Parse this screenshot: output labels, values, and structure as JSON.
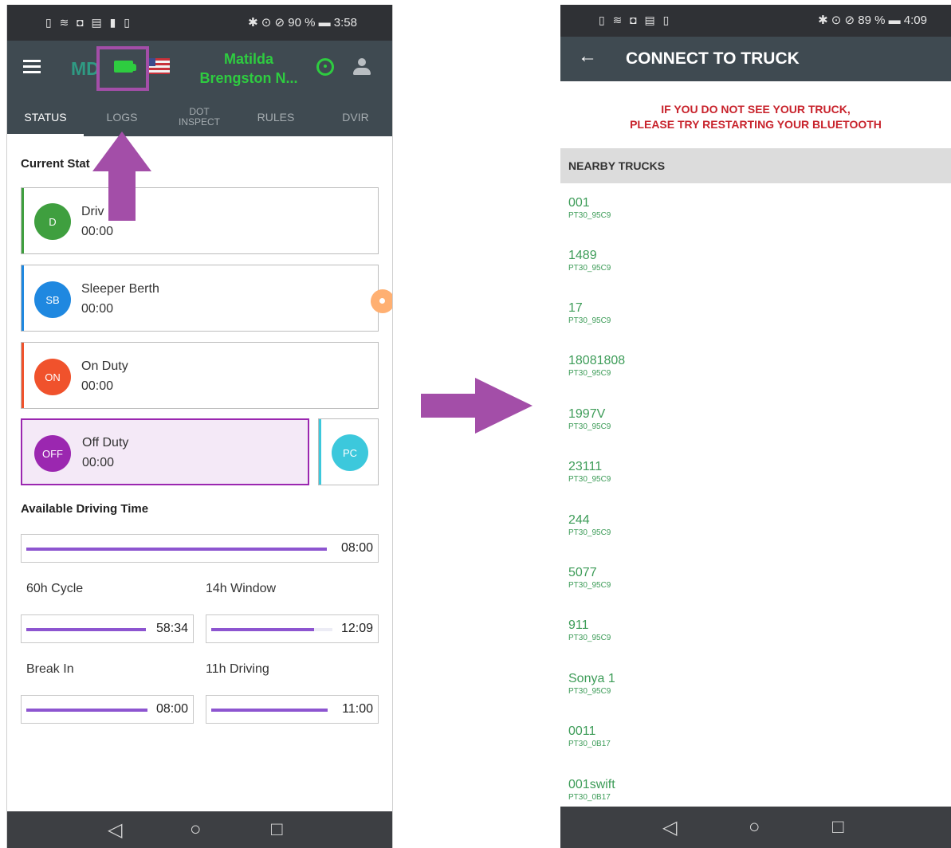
{
  "left_phone": {
    "status_bar": {
      "icons": "▯ ≋ ◘ ▤ ▮ ▯",
      "right": "✱ ⊙ ⊘ 90 % ▬ 3:58"
    },
    "app_bar": {
      "logo": "MD",
      "driver_name_line1": "Matilda",
      "driver_name_line2": "Brengston N..."
    },
    "tabs": [
      {
        "label": "STATUS",
        "active": true
      },
      {
        "label": "LOGS",
        "active": false
      },
      {
        "label_line1": "DOT",
        "label_line2": "INSPECT",
        "active": false
      },
      {
        "label": "RULES",
        "active": false
      },
      {
        "label": "DVIR",
        "active": false
      }
    ],
    "current_status_title": "Current Stat",
    "statuses": [
      {
        "code": "D",
        "name": "Driv",
        "time": "00:00",
        "color": "#3f9f3f"
      },
      {
        "code": "SB",
        "name": "Sleeper Berth",
        "time": "00:00",
        "color": "#1f88e0"
      },
      {
        "code": "ON",
        "name": "On Duty",
        "time": "00:00",
        "color": "#f0522c"
      },
      {
        "code": "OFF",
        "name": "Off Duty",
        "time": "00:00",
        "color": "#9b27b0",
        "selected": true
      },
      {
        "code": "PC",
        "color": "#3cc8dc"
      }
    ],
    "available_title": "Available Driving Time",
    "available": {
      "value": "08:00",
      "fill": 1.0
    },
    "cycle": {
      "label": "60h Cycle",
      "value": "58:34",
      "fill": 1.0
    },
    "window": {
      "label": "14h Window",
      "value": "12:09",
      "fill": 0.85
    },
    "break": {
      "label": "Break In",
      "value": "08:00",
      "fill": 1.0
    },
    "driving": {
      "label": "11h Driving",
      "value": "11:00",
      "fill": 1.0
    },
    "nav": {
      "back": "◁",
      "home": "○",
      "recent": "□"
    }
  },
  "right_phone": {
    "status_bar": {
      "icons": "▯ ≋ ◘ ▤ ▯",
      "right": "✱ ⊙ ⊘ 89 % ▬ 4:09"
    },
    "title": "CONNECT TO TRUCK",
    "back_icon": "←",
    "warning_line1": "IF YOU DO NOT SEE YOUR TRUCK,",
    "warning_line2": "PLEASE TRY RESTARTING YOUR BLUETOOTH",
    "nearby_title": "NEARBY TRUCKS",
    "trucks": [
      {
        "name": "001",
        "id": "PT30_95C9"
      },
      {
        "name": "1489",
        "id": "PT30_95C9"
      },
      {
        "name": "17",
        "id": "PT30_95C9"
      },
      {
        "name": "18081808",
        "id": "PT30_95C9"
      },
      {
        "name": "1997V",
        "id": "PT30_95C9"
      },
      {
        "name": "23111",
        "id": "PT30_95C9"
      },
      {
        "name": "244",
        "id": "PT30_95C9"
      },
      {
        "name": "5077",
        "id": "PT30_95C9"
      },
      {
        "name": "911",
        "id": "PT30_95C9"
      },
      {
        "name": "Sonya 1",
        "id": "PT30_95C9"
      },
      {
        "name": "0011",
        "id": "PT30_0B17"
      },
      {
        "name": "001swift",
        "id": "PT30_0B17"
      }
    ],
    "nav": {
      "back": "◁",
      "home": "○",
      "recent": "□"
    }
  },
  "colors": {
    "accent": "#a34ea8",
    "progress": "#8d55d0",
    "truck_text": "#3d9c58",
    "warning": "#c8232c"
  }
}
